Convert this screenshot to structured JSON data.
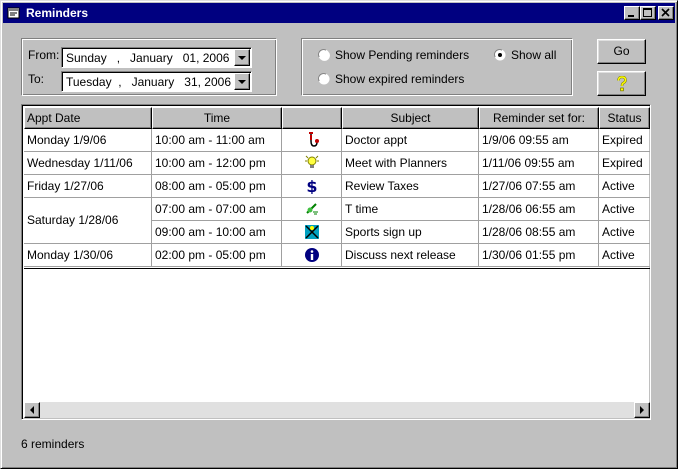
{
  "window": {
    "title": "Reminders",
    "minimize_icon": "minimize-icon",
    "maximize_icon": "maximize-icon",
    "close_icon": "close-icon"
  },
  "date_range": {
    "from_label": "From:",
    "to_label": "To:",
    "from_value": "Sunday   ,   January   01, 2006",
    "to_value": "Tuesday  ,   January   31, 2006"
  },
  "filter": {
    "pending_label": "Show Pending reminders",
    "expired_label": "Show expired reminders",
    "all_label": "Show all",
    "selected": "all"
  },
  "buttons": {
    "go_label": "Go",
    "help_label": "?"
  },
  "table": {
    "columns": [
      "Appt Date",
      "Time",
      "",
      "Subject",
      "Reminder set for:",
      "Status"
    ],
    "rows": [
      {
        "date": "Monday  1/9/06",
        "time": "10:00 am - 11:00 am",
        "icon": "doctor-icon",
        "subject": "Doctor appt",
        "reminder": "1/9/06 09:55 am",
        "status": "Expired"
      },
      {
        "date": "Wednesday  1/11/06",
        "time": "10:00 am - 12:00 pm",
        "icon": "lightbulb-icon",
        "subject": "Meet with Planners",
        "reminder": "1/11/06 09:55 am",
        "status": "Expired"
      },
      {
        "date": "Friday  1/27/06",
        "time": "08:00 am - 05:00 pm",
        "icon": "dollar-icon",
        "subject": "Review Taxes",
        "reminder": "1/27/06 07:55 am",
        "status": "Active"
      },
      {
        "date": "Saturday  1/28/06",
        "time": "07:00 am - 07:00 am",
        "icon": "tee-icon",
        "subject": "T time",
        "reminder": "1/28/06 06:55 am",
        "status": "Active"
      },
      {
        "date": "",
        "time": "09:00 am - 10:00 am",
        "icon": "sports-icon",
        "subject": "Sports sign up",
        "reminder": "1/28/06 08:55 am",
        "status": "Active"
      },
      {
        "date": "Monday  1/30/06",
        "time": "02:00 pm - 05:00 pm",
        "icon": "info-icon",
        "subject": "Discuss next release",
        "reminder": "1/30/06 01:55 pm",
        "status": "Active"
      }
    ]
  },
  "status": {
    "count_text": "6 reminders"
  }
}
